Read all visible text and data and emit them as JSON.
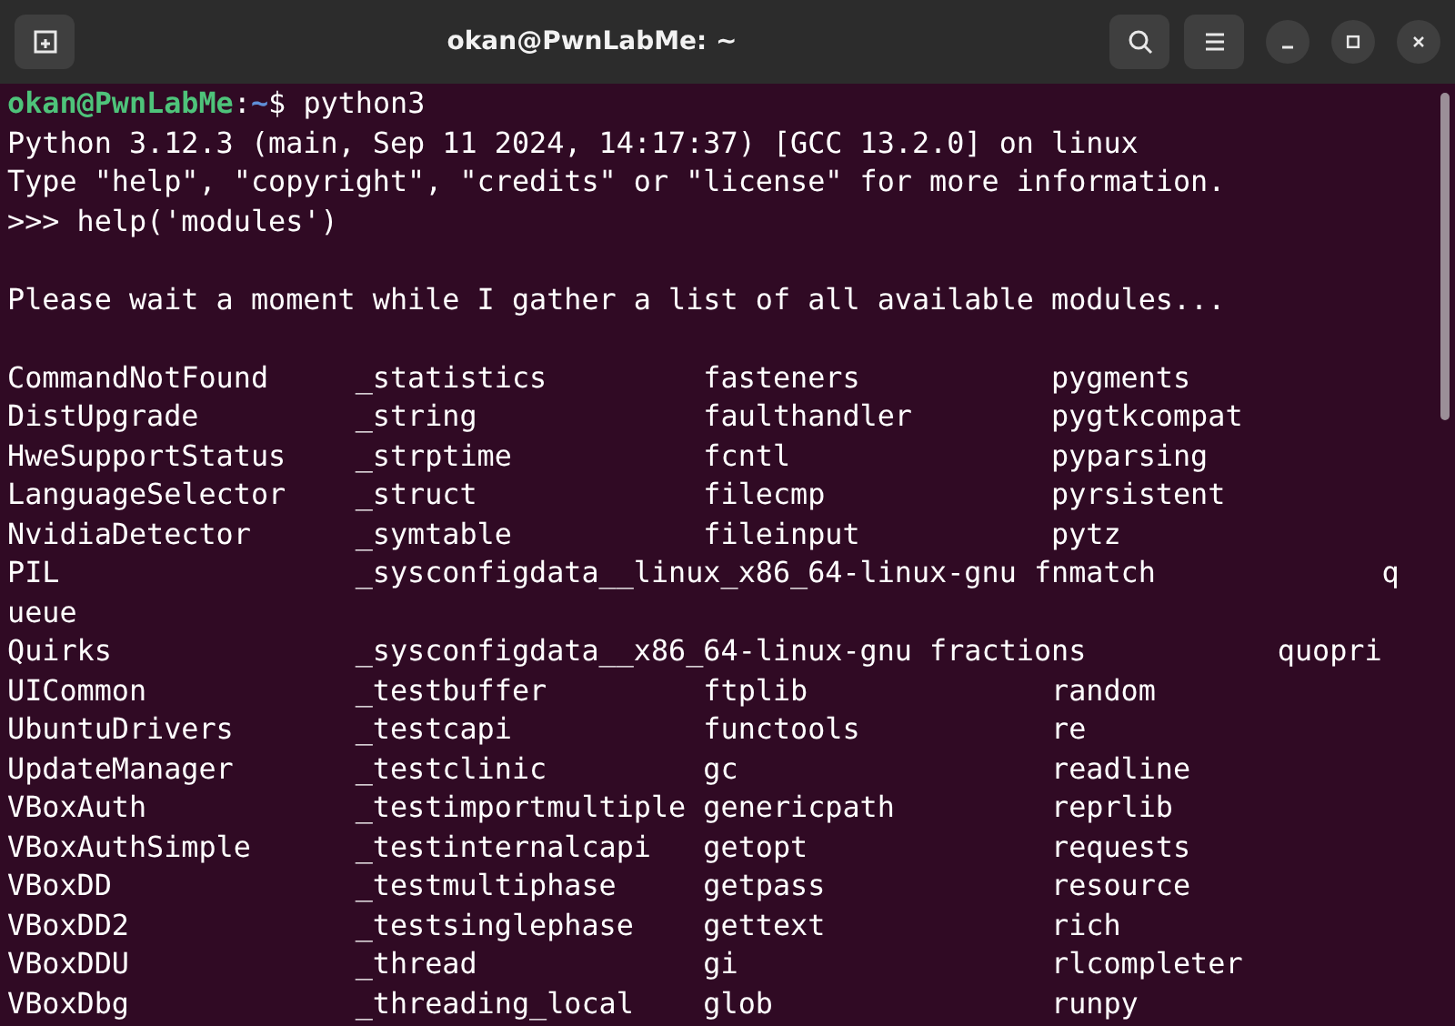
{
  "window": {
    "title": "okan@PwnLabMe: ~"
  },
  "terminal": {
    "lines": [
      {
        "kind": "prompt",
        "user_host": "okan@PwnLabMe",
        "separator": ":",
        "path": "~",
        "symbol": "$",
        "command": "python3"
      },
      {
        "kind": "output",
        "text": "Python 3.12.3 (main, Sep 11 2024, 14:17:37) [GCC 13.2.0] on linux"
      },
      {
        "kind": "output",
        "text": "Type \"help\", \"copyright\", \"credits\" or \"license\" for more information."
      },
      {
        "kind": "output",
        "text": ">>> help('modules')"
      },
      {
        "kind": "blank"
      },
      {
        "kind": "output",
        "text": "Please wait a moment while I gather a list of all available modules..."
      },
      {
        "kind": "blank"
      },
      {
        "kind": "output",
        "text": "CommandNotFound     _statistics         fasteners           pygments"
      },
      {
        "kind": "output",
        "text": "DistUpgrade         _string             faulthandler        pygtkcompat"
      },
      {
        "kind": "output",
        "text": "HweSupportStatus    _strptime           fcntl               pyparsing"
      },
      {
        "kind": "output",
        "text": "LanguageSelector    _struct             filecmp             pyrsistent"
      },
      {
        "kind": "output",
        "text": "NvidiaDetector      _symtable           fileinput           pytz"
      },
      {
        "kind": "output",
        "text": "PIL                 _sysconfigdata__linux_x86_64-linux-gnu fnmatch             q"
      },
      {
        "kind": "output",
        "text": "ueue"
      },
      {
        "kind": "output",
        "text": "Quirks              _sysconfigdata__x86_64-linux-gnu fractions           quopri"
      },
      {
        "kind": "output",
        "text": "UICommon            _testbuffer         ftplib              random"
      },
      {
        "kind": "output",
        "text": "UbuntuDrivers       _testcapi           functools           re"
      },
      {
        "kind": "output",
        "text": "UpdateManager       _testclinic         gc                  readline"
      },
      {
        "kind": "output",
        "text": "VBoxAuth            _testimportmultiple genericpath         reprlib"
      },
      {
        "kind": "output",
        "text": "VBoxAuthSimple      _testinternalcapi   getopt              requests"
      },
      {
        "kind": "output",
        "text": "VBoxDD              _testmultiphase     getpass             resource"
      },
      {
        "kind": "output",
        "text": "VBoxDD2             _testsinglephase    gettext             rich"
      },
      {
        "kind": "output",
        "text": "VBoxDDU             _thread             gi                  rlcompleter"
      },
      {
        "kind": "output",
        "text": "VBoxDbg             _threading_local    glob                runpy"
      }
    ]
  }
}
